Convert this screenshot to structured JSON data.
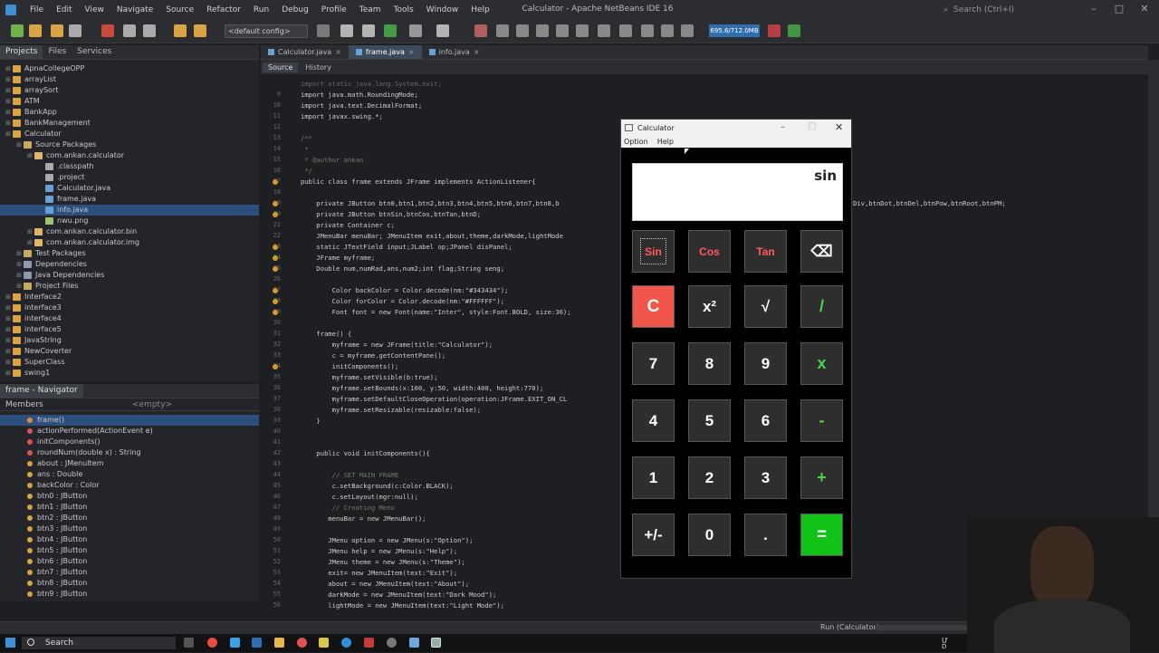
{
  "titlebar": {
    "menu": [
      "File",
      "Edit",
      "View",
      "Navigate",
      "Source",
      "Refactor",
      "Run",
      "Debug",
      "Profile",
      "Team",
      "Tools",
      "Window",
      "Help"
    ],
    "title": "Calculator - Apache NetBeans IDE 16",
    "search_placeholder": "Search (Ctrl+I)"
  },
  "toolbar": {
    "config": "<default config>",
    "memory": "695.6/712.0MB"
  },
  "projects_panel": {
    "tabs": [
      "Projects",
      "Files",
      "Services"
    ],
    "tree": [
      {
        "label": "ApnaCollegeOPP",
        "indent": 0,
        "icon": "#d9a441"
      },
      {
        "label": "arrayList",
        "indent": 0,
        "icon": "#d9a441"
      },
      {
        "label": "arraySort",
        "indent": 0,
        "icon": "#d9a441"
      },
      {
        "label": "ATM",
        "indent": 0,
        "icon": "#d9a441"
      },
      {
        "label": "BankApp",
        "indent": 0,
        "icon": "#d9a441"
      },
      {
        "label": "BankManagement",
        "indent": 0,
        "icon": "#d9a441"
      },
      {
        "label": "Calculator",
        "indent": 0,
        "icon": "#d9a441"
      },
      {
        "label": "Source Packages",
        "indent": 1,
        "icon": "#c9a860"
      },
      {
        "label": "com.ankan.calculator",
        "indent": 2,
        "icon": "#e0b56a"
      },
      {
        "label": ".classpath",
        "indent": 3,
        "icon": "#aaaaaa"
      },
      {
        "label": ".project",
        "indent": 3,
        "icon": "#aaaaaa"
      },
      {
        "label": "Calculator.java",
        "indent": 3,
        "icon": "#6aa0d8"
      },
      {
        "label": "frame.java",
        "indent": 3,
        "icon": "#6aa0d8"
      },
      {
        "label": "info.java",
        "indent": 3,
        "icon": "#6aa0d8"
      },
      {
        "label": "nwu.png",
        "indent": 3,
        "icon": "#9cc46b"
      },
      {
        "label": "com.ankan.calculator.bin",
        "indent": 2,
        "icon": "#e0b56a"
      },
      {
        "label": "com.ankan.calculator.img",
        "indent": 2,
        "icon": "#e0b56a"
      },
      {
        "label": "Test Packages",
        "indent": 1,
        "icon": "#c9a860"
      },
      {
        "label": "Dependencies",
        "indent": 1,
        "icon": "#8d9bb0"
      },
      {
        "label": "Java Dependencies",
        "indent": 1,
        "icon": "#8d9bb0"
      },
      {
        "label": "Project Files",
        "indent": 1,
        "icon": "#c9a860"
      },
      {
        "label": "Interface2",
        "indent": 0,
        "icon": "#d9a441"
      },
      {
        "label": "interface3",
        "indent": 0,
        "icon": "#d9a441"
      },
      {
        "label": "interface4",
        "indent": 0,
        "icon": "#d9a441"
      },
      {
        "label": "interface5",
        "indent": 0,
        "icon": "#d9a441"
      },
      {
        "label": "JavaString",
        "indent": 0,
        "icon": "#d9a441"
      },
      {
        "label": "NewCoverter",
        "indent": 0,
        "icon": "#d9a441"
      },
      {
        "label": "SuperClass",
        "indent": 0,
        "icon": "#d9a441"
      },
      {
        "label": "swing1",
        "indent": 0,
        "icon": "#d9a441"
      }
    ],
    "selected": "info.java"
  },
  "navigator": {
    "tab": "frame - Navigator",
    "members_label": "Members",
    "filter_placeholder": "<empty>",
    "members": [
      {
        "label": "frame()",
        "color": "#e38b3a"
      },
      {
        "label": "actionPerformed(ActionEvent e)",
        "color": "#e05252"
      },
      {
        "label": "initComponents()",
        "color": "#e05252"
      },
      {
        "label": "roundNum(double x) : String",
        "color": "#e05252"
      },
      {
        "label": "about : JMenuItem",
        "color": "#d9a441"
      },
      {
        "label": "ans : Double",
        "color": "#d9a441"
      },
      {
        "label": "backColor : Color",
        "color": "#d9a441"
      },
      {
        "label": "btn0 : JButton",
        "color": "#d9a441"
      },
      {
        "label": "btn1 : JButton",
        "color": "#d9a441"
      },
      {
        "label": "btn2 : JButton",
        "color": "#d9a441"
      },
      {
        "label": "btn3 : JButton",
        "color": "#d9a441"
      },
      {
        "label": "btn4 : JButton",
        "color": "#d9a441"
      },
      {
        "label": "btn5 : JButton",
        "color": "#d9a441"
      },
      {
        "label": "btn6 : JButton",
        "color": "#d9a441"
      },
      {
        "label": "btn7 : JButton",
        "color": "#d9a441"
      },
      {
        "label": "btn8 : JButton",
        "color": "#d9a441"
      },
      {
        "label": "btn9 : JButton",
        "color": "#d9a441"
      }
    ]
  },
  "editor": {
    "tabs": [
      "Calculator.java",
      "frame.java",
      "info.java"
    ],
    "active_tab": "frame.java",
    "source_tab": "Source",
    "history_tab": "History",
    "line_numbers": [
      "",
      "9",
      "10",
      "11",
      "12",
      "13",
      "14",
      "15",
      "16",
      "17",
      "18",
      "19",
      "20",
      "21",
      "22",
      "23",
      "24",
      "25",
      "26",
      "27",
      "28",
      "29",
      "30",
      "31",
      "32",
      "33",
      "34",
      "35",
      "36",
      "37",
      "38",
      "39",
      "40",
      "41",
      "42",
      "43",
      "44",
      "45",
      "46",
      "47",
      "48",
      "49",
      "50",
      "51",
      "52",
      "53",
      "54",
      "55",
      "56"
    ]
  },
  "code_lines": [
    "import static java.lang.System.exit;",
    "import java.math.RoundingMode;",
    "import java.text.DecimalFormat;",
    "import javax.swing.*;",
    "",
    "/**",
    " *",
    " * @author ankan",
    " */",
    "public class frame extends JFrame implements ActionListener{",
    "",
    "    private JButton btn0,btn1,btn2,btn3,btn4,btn5,btn6,btn7,btn8,b",
    "    private JButton btnSin,btnCos,btnTan,btnD;",
    "    private Container c;",
    "    JMenuBar menuBar; JMenuItem exit,about,theme,darkMode,lightMode",
    "    static JTextField input;JLabel op;JPanel disPanel;",
    "    JFrame myframe;",
    "    Double num,numRad,ans,num2;int flag;String seng;",
    "",
    "        Color backColor = Color.decode(nm:\"#343434\");",
    "        Color forColor = Color.decode(nm:\"#FFFFFF\");",
    "        Font font = new Font(name:\"Inter\", style:Font.BOLD, size:36);",
    "",
    "    frame() {",
    "        myframe = new JFrame(title:\"Calculator\");",
    "        c = myframe.getContentPane();",
    "        initComponents();",
    "        myframe.setVisible(b:true);",
    "        myframe.setBounds(x:100, y:50, width:400, height:770);",
    "        myframe.setDefaultCloseOperation(operation:JFrame.EXIT_ON_CL",
    "        myframe.setResizable(resizable:false);",
    "    }",
    "",
    "",
    "    public void initComponents(){",
    "",
    "        // SET MAIN FRAME",
    "        c.setBackground(c:Color.BLACK);",
    "        c.setLayout(mgr:null);",
    "        // Creating Menu",
    "       menuBar = new JMenuBar();",
    "",
    "       JMenu option = new JMenu(s:\"Option\");",
    "       JMenu help = new JMenu(s:\"Help\");",
    "       JMenu theme = new JMenu(s:\"Theme\");",
    "       exit= new JMenuItem(text:\"Exit\");",
    "       about = new JMenuItem(text:\"About\");",
    "       darkMode = new JMenuItem(text:\"Dark Mood\");",
    "       lightMode = new JMenuItem(text:\"Light Mode\");"
  ],
  "code_overflow": "Div,btnDot,btnDel,btnPow,btnRoot,btnPM;",
  "calculator": {
    "title": "Calculator",
    "menu": [
      "Option",
      "Help"
    ],
    "display": "sin",
    "buttons": [
      {
        "label": "Sin",
        "style": "red",
        "selected": true
      },
      {
        "label": "Cos",
        "style": "red"
      },
      {
        "label": "Tan",
        "style": "red"
      },
      {
        "label": "⌫",
        "style": "plain"
      },
      {
        "label": "C",
        "style": "red-bg"
      },
      {
        "label": "x²",
        "style": "plain"
      },
      {
        "label": "√",
        "style": "plain"
      },
      {
        "label": "/",
        "style": "green"
      },
      {
        "label": "7",
        "style": "plain"
      },
      {
        "label": "8",
        "style": "plain"
      },
      {
        "label": "9",
        "style": "plain"
      },
      {
        "label": "x",
        "style": "green"
      },
      {
        "label": "4",
        "style": "plain"
      },
      {
        "label": "5",
        "style": "plain"
      },
      {
        "label": "6",
        "style": "plain"
      },
      {
        "label": "-",
        "style": "green"
      },
      {
        "label": "1",
        "style": "plain"
      },
      {
        "label": "2",
        "style": "plain"
      },
      {
        "label": "3",
        "style": "plain"
      },
      {
        "label": "+",
        "style": "green"
      },
      {
        "label": "+/-",
        "style": "plain"
      },
      {
        "label": "0",
        "style": "plain"
      },
      {
        "label": ".",
        "style": "plain"
      },
      {
        "label": "=",
        "style": "green-bg"
      }
    ]
  },
  "status": {
    "run": "Run (Calculator)"
  },
  "taskbar": {
    "search": "Search",
    "tray_left": "Ư",
    "tray_right": "D"
  }
}
